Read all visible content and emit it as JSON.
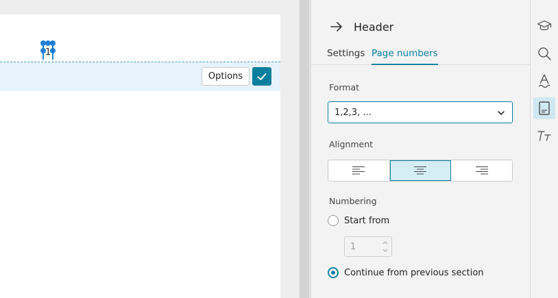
{
  "document": {
    "page_number": "1",
    "options_label": "Options"
  },
  "panel": {
    "title": "Header",
    "tabs": [
      {
        "label": "Settings",
        "active": false
      },
      {
        "label": "Page numbers",
        "active": true
      }
    ],
    "format": {
      "label": "Format",
      "value": "1,2,3, ..."
    },
    "alignment": {
      "label": "Alignment",
      "options": [
        "left",
        "center",
        "right"
      ],
      "selected": "center"
    },
    "numbering": {
      "label": "Numbering",
      "start_from_label": "Start from",
      "start_from_value": "1",
      "start_from_checked": false,
      "continue_label": "Continue from previous section",
      "continue_checked": true
    }
  },
  "toolbar": {
    "items": [
      "graduation-cap-icon",
      "search-icon",
      "text-style-icon",
      "header-footer-icon",
      "font-size-icon"
    ],
    "active": "header-footer-icon"
  },
  "colors": {
    "accent": "#0b7f9e",
    "header_band": "#e7f3fb",
    "caret": "#1e7fd2"
  }
}
